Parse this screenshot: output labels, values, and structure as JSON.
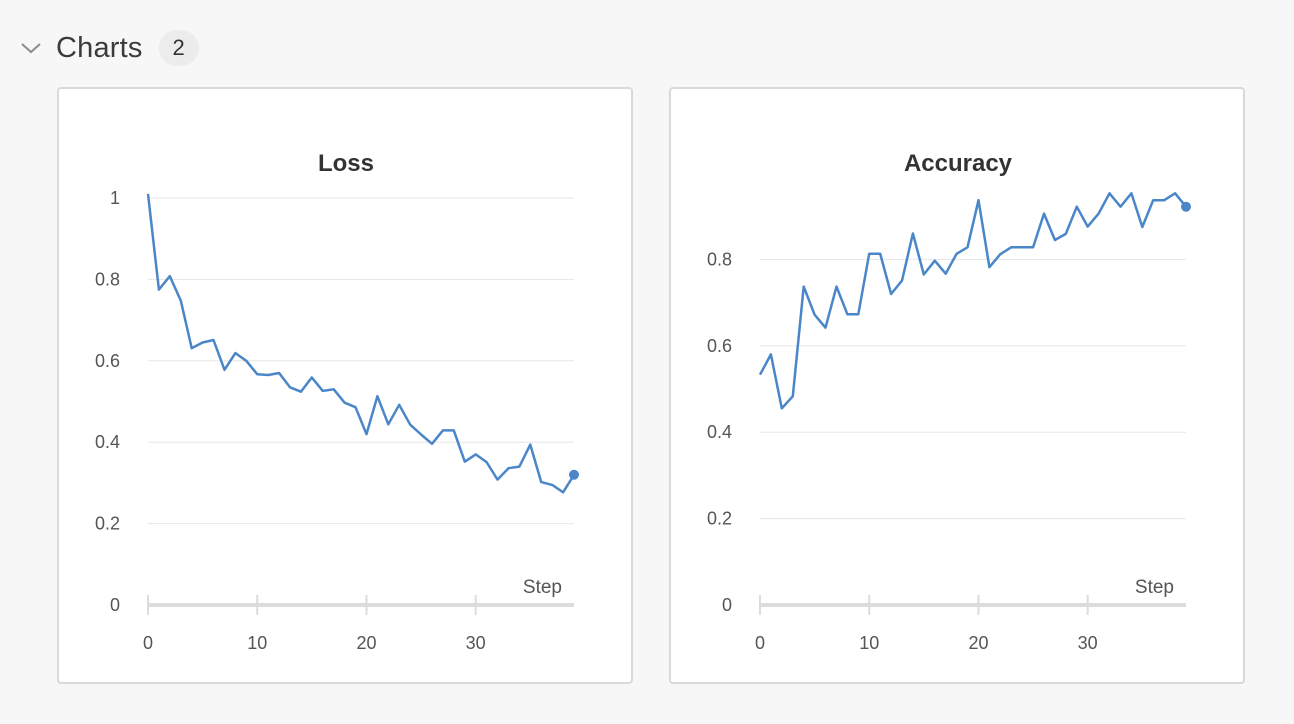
{
  "section": {
    "title": "Charts",
    "count": "2"
  },
  "colors": {
    "line": "#4a86c8",
    "grid": "#e6e6e6",
    "axis": "#dcdcdc",
    "background": "#f7f7f7",
    "panel": "#ffffff"
  },
  "icons": {
    "collapse": "chevron-down-icon"
  },
  "chart_data": [
    {
      "type": "line",
      "title": "Loss",
      "xlabel": "Step",
      "ylabel": "",
      "xlim": [
        0,
        39
      ],
      "ylim": [
        0,
        1
      ],
      "xticks": [
        0,
        10,
        20,
        30
      ],
      "yticks": [
        0,
        0.2,
        0.4,
        0.6,
        0.8,
        1
      ],
      "ytick_labels": [
        "0",
        "0.2",
        "0.4",
        "0.6",
        "0.8",
        "1"
      ],
      "grid": true,
      "legend": "none",
      "last_point_marker": true,
      "series": [
        {
          "x": [
            0,
            1,
            2,
            3,
            4,
            5,
            6,
            7,
            8,
            9,
            10,
            11,
            12,
            13,
            14,
            15,
            16,
            17,
            18,
            19,
            20,
            21,
            22,
            23,
            24,
            25,
            26,
            27,
            28,
            29,
            30,
            31,
            32,
            33,
            34,
            35,
            36,
            37,
            38,
            39
          ],
          "values": [
            1.01,
            0.775,
            0.808,
            0.748,
            0.631,
            0.645,
            0.651,
            0.578,
            0.619,
            0.6,
            0.567,
            0.565,
            0.57,
            0.535,
            0.524,
            0.559,
            0.526,
            0.53,
            0.497,
            0.486,
            0.42,
            0.513,
            0.444,
            0.492,
            0.443,
            0.419,
            0.396,
            0.429,
            0.429,
            0.352,
            0.37,
            0.351,
            0.308,
            0.336,
            0.34,
            0.394,
            0.302,
            0.295,
            0.277,
            0.32
          ]
        }
      ]
    },
    {
      "type": "line",
      "title": "Accuracy",
      "xlabel": "Step",
      "ylabel": "",
      "xlim": [
        0,
        39
      ],
      "ylim": [
        0,
        0.95
      ],
      "xticks": [
        0,
        10,
        20,
        30
      ],
      "yticks": [
        0,
        0.2,
        0.4,
        0.6,
        0.8
      ],
      "ytick_labels": [
        "0",
        "0.2",
        "0.4",
        "0.6",
        "0.8"
      ],
      "grid": true,
      "legend": "none",
      "last_point_marker": true,
      "series": [
        {
          "x": [
            0,
            1,
            2,
            3,
            4,
            5,
            6,
            7,
            8,
            9,
            10,
            11,
            12,
            13,
            14,
            15,
            16,
            17,
            18,
            19,
            20,
            21,
            22,
            23,
            24,
            25,
            26,
            27,
            28,
            29,
            30,
            31,
            32,
            33,
            34,
            35,
            36,
            37,
            38,
            39
          ],
          "values": [
            0.533,
            0.58,
            0.455,
            0.483,
            0.737,
            0.672,
            0.642,
            0.737,
            0.673,
            0.673,
            0.813,
            0.813,
            0.72,
            0.751,
            0.86,
            0.765,
            0.797,
            0.767,
            0.813,
            0.828,
            0.937,
            0.782,
            0.812,
            0.828,
            0.828,
            0.828,
            0.906,
            0.845,
            0.859,
            0.922,
            0.876,
            0.906,
            0.953,
            0.922,
            0.953,
            0.875,
            0.937,
            0.937,
            0.953,
            0.922
          ]
        }
      ]
    }
  ]
}
